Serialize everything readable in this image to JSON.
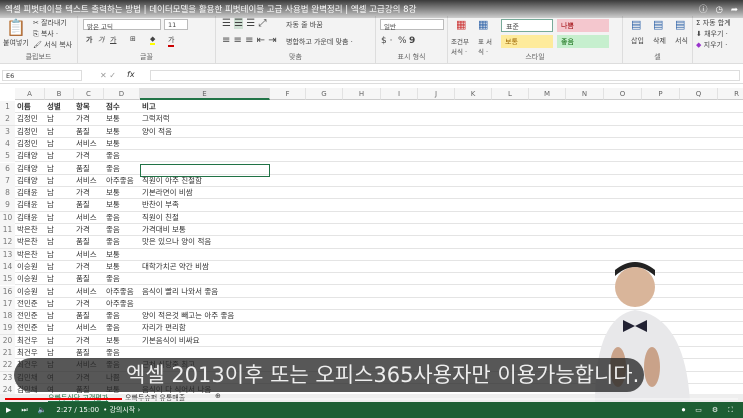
{
  "video": {
    "title": "엑셀 피벗테이블 텍스트 출력하는 방법 | 데이터모델을 활용한 피벗테이블 고급 사용법 완벽정리 | 엑셀 고급강의 8강",
    "subtitle": "엑셀 2013이후 또는 오피스365사용자만 이용가능합니다.",
    "time": "2:27 / 15:00",
    "chapter": "• 강의시작 ›",
    "progress_percent": 16
  },
  "ribbon": {
    "clipboard": {
      "paste": "붙여넣기",
      "cut": "잘라내기",
      "copy": "복사 ·",
      "format_painter": "서식 복사",
      "label": "클립보드"
    },
    "font": {
      "name": "맑은 고딕",
      "size": "11",
      "bold": "가",
      "italic": "가",
      "underline": "가",
      "label": "글꼴"
    },
    "align": {
      "wrap": "자동 줄 바꿈",
      "merge": "병합하고 가운데 맞춤 ·",
      "label": "맞춤"
    },
    "number": {
      "format": "일반",
      "currency": "$ ·",
      "percent": "%",
      "comma": "9",
      "label": "표시 형식"
    },
    "styles": {
      "conditional": "조건부 서식 ·",
      "table": "표 서식 ·",
      "normal": "표준",
      "bad": "나쁨",
      "neutral": "보통",
      "good": "좋음",
      "label": "스타일"
    },
    "cells": {
      "insert": "삽입",
      "delete": "삭제",
      "format": "서식",
      "label": "셀"
    },
    "editing": {
      "autosum": "자동 합계",
      "fill": "채우기 ·",
      "clear": "지우기 ·"
    }
  },
  "formula": {
    "namebox": "E6",
    "fx": "fx"
  },
  "columns": [
    "A",
    "B",
    "C",
    "D",
    "E",
    "F",
    "G",
    "H",
    "I",
    "J",
    "K",
    "L",
    "M",
    "N",
    "O",
    "P",
    "Q",
    "R"
  ],
  "rows": [
    [
      "1",
      "이름",
      "성별",
      "항목",
      "점수",
      "비고"
    ],
    [
      "2",
      "김정민",
      "남",
      "가격",
      "보통",
      "그럭저럭"
    ],
    [
      "3",
      "김정민",
      "남",
      "품질",
      "보통",
      "양이 적음"
    ],
    [
      "4",
      "김정민",
      "남",
      "서비스",
      "보통",
      ""
    ],
    [
      "5",
      "김태양",
      "남",
      "가격",
      "좋음",
      ""
    ],
    [
      "6",
      "김태양",
      "남",
      "품질",
      "좋음",
      ""
    ],
    [
      "7",
      "김태양",
      "남",
      "서비스",
      "아주좋음",
      "직원이 아주 친절함"
    ],
    [
      "8",
      "김태윤",
      "남",
      "가격",
      "보통",
      "기본라면이 비쌈"
    ],
    [
      "9",
      "김태윤",
      "남",
      "품질",
      "보통",
      "반찬이 부족"
    ],
    [
      "10",
      "김태윤",
      "남",
      "서비스",
      "좋음",
      "직원이 친절"
    ],
    [
      "11",
      "박은찬",
      "남",
      "가격",
      "좋음",
      "가격대비 보통"
    ],
    [
      "12",
      "박은찬",
      "남",
      "품질",
      "좋음",
      "맛은 있으나 양이 적음"
    ],
    [
      "13",
      "박은찬",
      "남",
      "서비스",
      "보통",
      ""
    ],
    [
      "14",
      "이승원",
      "남",
      "가격",
      "보통",
      "대학가치곤 약간 비쌈"
    ],
    [
      "15",
      "이승원",
      "남",
      "품질",
      "좋음",
      ""
    ],
    [
      "16",
      "이승원",
      "남",
      "서비스",
      "아주좋음",
      "음식이 빨리 나와서 좋음"
    ],
    [
      "17",
      "전민준",
      "남",
      "가격",
      "아주좋음",
      ""
    ],
    [
      "18",
      "전민준",
      "남",
      "품질",
      "좋음",
      "양이 적은것 빼고는 아주 좋음"
    ],
    [
      "19",
      "전민준",
      "남",
      "서비스",
      "좋음",
      "자리가 편리함"
    ],
    [
      "20",
      "최건우",
      "남",
      "가격",
      "보통",
      "기본음식이 비싸요"
    ],
    [
      "21",
      "최건우",
      "남",
      "품질",
      "좋음",
      ""
    ],
    [
      "22",
      "최건우",
      "남",
      "서비스",
      "좋음",
      "근처 식당중 최고"
    ],
    [
      "23",
      "김민채",
      "여",
      "가격",
      "나쁨",
      ""
    ],
    [
      "24",
      "김민채",
      "여",
      "품질",
      "보통",
      "음식이 다 식어서 나옴"
    ]
  ],
  "sheets": [
    "오빠두식당 고객평가",
    "오빠두슈퍼 유통매출"
  ]
}
